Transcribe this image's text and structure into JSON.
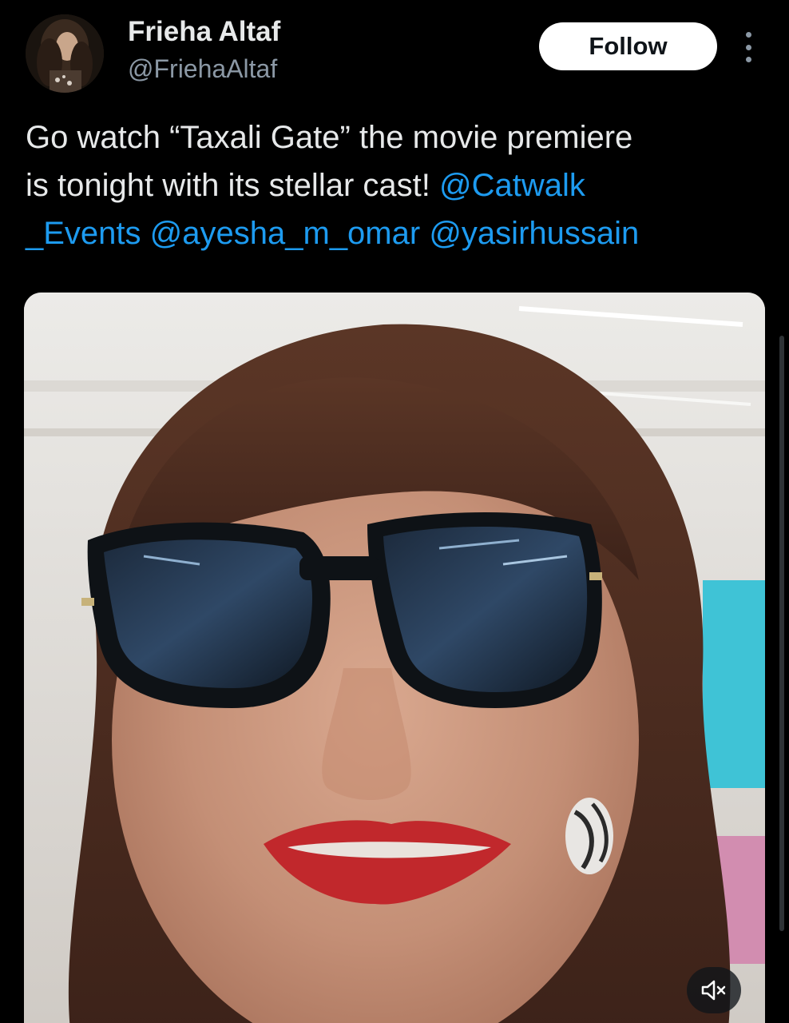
{
  "author": {
    "display_name": "Frieha Altaf",
    "handle": "@FriehaAltaf",
    "avatar_icon": "profile-photo"
  },
  "actions": {
    "follow_label": "Follow",
    "more_icon": "more-vertical-icon"
  },
  "tweet": {
    "line1": "Go watch “Taxali Gate” the movie premiere",
    "line2_text": "is tonight with its stellar cast! ",
    "line2_mention": "@Catwalk",
    "line3_mention1": "_Events",
    "line3_mention2": "@ayesha_m_omar",
    "line3_mention3": "@yasirhussain"
  },
  "media": {
    "type": "video",
    "description_icon": "video-still",
    "mute_icon": "volume-muted-icon"
  },
  "colors": {
    "background": "#000000",
    "text_primary": "#e7e9ea",
    "text_secondary": "#8b98a5",
    "link": "#1d9bf0",
    "follow_button_bg": "#ffffff",
    "follow_button_text": "#0f1419"
  }
}
